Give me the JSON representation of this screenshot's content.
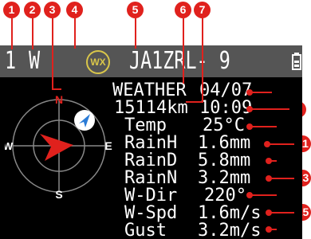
{
  "callouts": [
    "1",
    "2",
    "3",
    "4",
    "5",
    "6",
    "7",
    "8",
    "9",
    "10",
    "11",
    "12",
    "13",
    "14",
    "15",
    "16"
  ],
  "status_bar": {
    "channel": "1",
    "power": "W",
    "wx_badge": "WX",
    "callsign": "JA1ZRL- 9"
  },
  "compass": {
    "north": "N",
    "south": "S",
    "east": "E",
    "west": "W"
  },
  "weather": {
    "title": "WEATHER",
    "date": "04/07",
    "distance": "15114km",
    "time": "10:09",
    "rows": [
      {
        "label": "Temp",
        "value": "25°C"
      },
      {
        "label": "RainH",
        "value": "1.6mm"
      },
      {
        "label": "RainD",
        "value": "5.8mm"
      },
      {
        "label": "RainN",
        "value": "3.2mm"
      },
      {
        "label": "W-Dir",
        "value": "220°"
      },
      {
        "label": "W-Spd",
        "value": "1.6m/s"
      },
      {
        "label": "Gust",
        "value": "3.2m/s"
      }
    ]
  },
  "colors": {
    "callout": "#e0211d",
    "status_bar": "#555555",
    "wx_badge": "#d9c64a",
    "heading_arrow": "#e0211d",
    "station_icon": "#2a7bd6"
  },
  "icons": {
    "battery": "battery-icon",
    "station": "station-direction-icon",
    "heading": "heading-arrow-icon"
  }
}
